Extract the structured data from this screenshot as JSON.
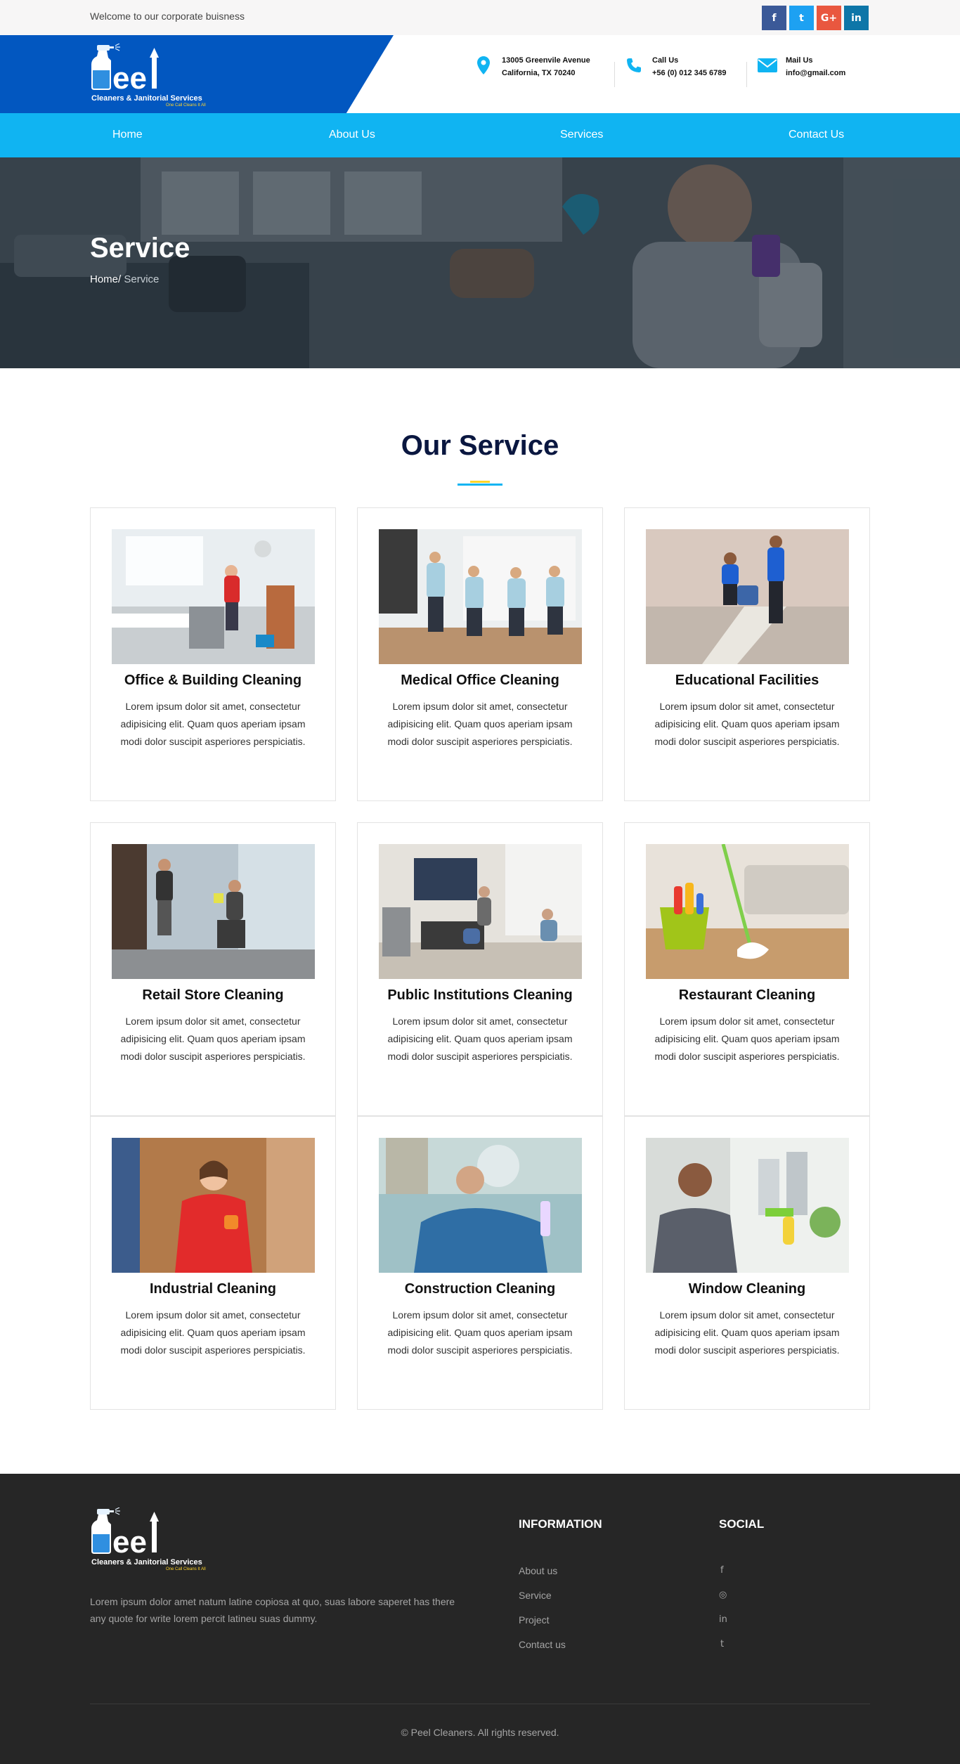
{
  "topbar": {
    "welcome": "Welcome to our corporate buisness",
    "social": [
      {
        "icon": "facebook-icon",
        "glyph": "f",
        "color": "#3b5998"
      },
      {
        "icon": "twitter-icon",
        "glyph": "t",
        "color": "#1da1f2"
      },
      {
        "icon": "google-plus-icon",
        "glyph": "G+",
        "color": "#e9573f"
      },
      {
        "icon": "linkedin-icon",
        "glyph": "in",
        "color": "#0e76a8"
      }
    ]
  },
  "brand": {
    "name": "eel",
    "tagline": "Cleaners & Janitorial Services",
    "slogan": "One Call Cleans It All",
    "primary_color": "#0257c0",
    "accent_color": "#10b4f2"
  },
  "contacts": [
    {
      "icon": "location-pin-icon",
      "line1": "13005 Greenvile Avenue",
      "line2": "California, TX 70240"
    },
    {
      "icon": "phone-icon",
      "line1": "Call Us",
      "line2": "+56 (0) 012 345 6789"
    },
    {
      "icon": "mail-icon",
      "line1": "Mail Us",
      "line2": "info@gmail.com"
    }
  ],
  "nav": {
    "home": "Home",
    "about": "About Us",
    "services": "Services",
    "contact": "Contact Us"
  },
  "hero": {
    "title": "Service",
    "crumb_home": "Home/",
    "crumb_current": " Service"
  },
  "services": {
    "heading": "Our Service",
    "items": [
      {
        "title": "Office & Building Cleaning",
        "desc": "Lorem ipsum dolor sit amet, consectetur adipisicing elit. Quam quos aperiam ipsam modi dolor suscipit asperiores perspiciatis."
      },
      {
        "title": "Medical Office Cleaning",
        "desc": "Lorem ipsum dolor sit amet, consectetur adipisicing elit. Quam quos aperiam ipsam modi dolor suscipit asperiores perspiciatis."
      },
      {
        "title": "Educational Facilities",
        "desc": "Lorem ipsum dolor sit amet, consectetur adipisicing elit. Quam quos aperiam ipsam modi dolor suscipit asperiores perspiciatis."
      },
      {
        "title": "Retail Store Cleaning",
        "desc": "Lorem ipsum dolor sit amet, consectetur adipisicing elit. Quam quos aperiam ipsam modi dolor suscipit asperiores perspiciatis."
      },
      {
        "title": "Public Institutions Cleaning",
        "desc": "Lorem ipsum dolor sit amet, consectetur adipisicing elit. Quam quos aperiam ipsam modi dolor suscipit asperiores perspiciatis."
      },
      {
        "title": "Restaurant Cleaning",
        "desc": "Lorem ipsum dolor sit amet, consectetur adipisicing elit. Quam quos aperiam ipsam modi dolor suscipit asperiores perspiciatis."
      },
      {
        "title": "Industrial Cleaning",
        "desc": "Lorem ipsum dolor sit amet, consectetur adipisicing elit. Quam quos aperiam ipsam modi dolor suscipit asperiores perspiciatis."
      },
      {
        "title": "Construction Cleaning",
        "desc": "Lorem ipsum dolor sit amet, consectetur adipisicing elit. Quam quos aperiam ipsam modi dolor suscipit asperiores perspiciatis."
      },
      {
        "title": "Window Cleaning",
        "desc": "Lorem ipsum dolor sit amet, consectetur adipisicing elit. Quam quos aperiam ipsam modi dolor suscipit asperiores perspiciatis."
      }
    ]
  },
  "footer": {
    "about": "Lorem ipsum dolor amet natum latine copiosa at quo, suas labore saperet has there any quote for write lorem percit latineu suas dummy.",
    "info_heading": "INFORMATION",
    "social_heading": "SOCIAL",
    "links": [
      "About us",
      "Service",
      "Project",
      "Contact us"
    ],
    "social": [
      {
        "icon": "facebook-icon",
        "glyph": "f"
      },
      {
        "icon": "dribbble-icon",
        "glyph": "◎"
      },
      {
        "icon": "linkedin-icon",
        "glyph": "in"
      },
      {
        "icon": "twitter-icon",
        "glyph": "t"
      }
    ],
    "copyright": "© Peel Cleaners. All rights reserved."
  }
}
